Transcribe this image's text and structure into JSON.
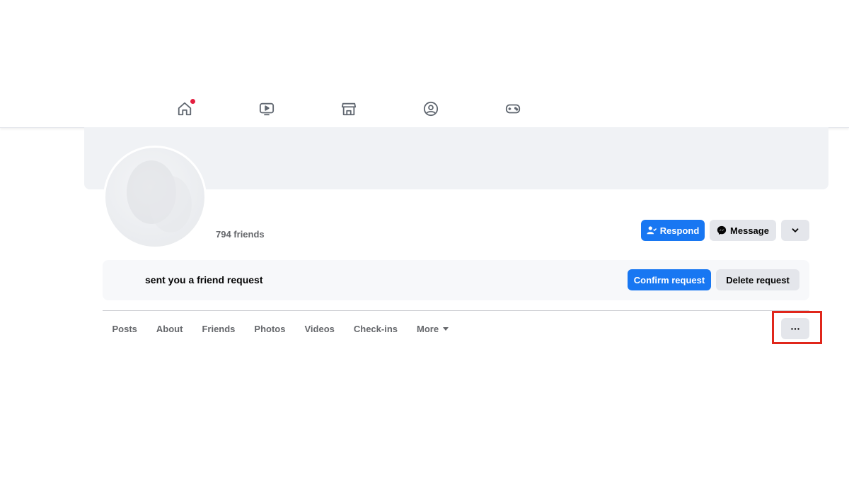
{
  "nav": {
    "icons": [
      "home-icon",
      "watch-video-icon",
      "marketplace-icon",
      "groups-icon",
      "gaming-icon"
    ],
    "icon_color": "#606770",
    "notification_dot_color": "#e41e3f"
  },
  "profile": {
    "friends_count": "794 friends"
  },
  "actions": {
    "respond_label": "Respond",
    "message_label": "Message",
    "primary_color": "#1877f2"
  },
  "friend_request": {
    "text": "sent you a friend request",
    "confirm_label": "Confirm request",
    "delete_label": "Delete request"
  },
  "tabs": [
    {
      "label": "Posts"
    },
    {
      "label": "About"
    },
    {
      "label": "Friends"
    },
    {
      "label": "Photos"
    },
    {
      "label": "Videos"
    },
    {
      "label": "Check-ins"
    },
    {
      "label": "More"
    }
  ],
  "highlight_color": "#e0261b"
}
